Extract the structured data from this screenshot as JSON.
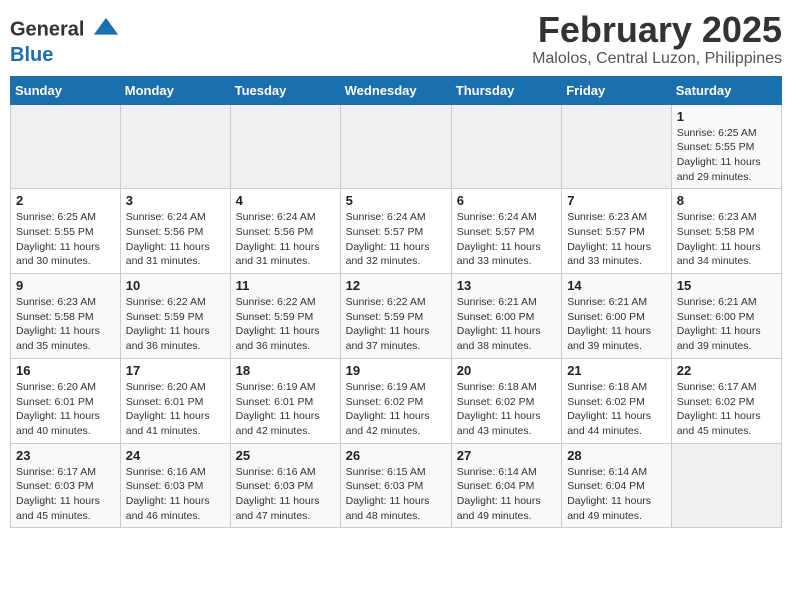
{
  "header": {
    "logo_general": "General",
    "logo_blue": "Blue",
    "month": "February 2025",
    "location": "Malolos, Central Luzon, Philippines"
  },
  "columns": [
    "Sunday",
    "Monday",
    "Tuesday",
    "Wednesday",
    "Thursday",
    "Friday",
    "Saturday"
  ],
  "weeks": [
    [
      {
        "day": "",
        "sunrise": "",
        "sunset": "",
        "daylight": ""
      },
      {
        "day": "",
        "sunrise": "",
        "sunset": "",
        "daylight": ""
      },
      {
        "day": "",
        "sunrise": "",
        "sunset": "",
        "daylight": ""
      },
      {
        "day": "",
        "sunrise": "",
        "sunset": "",
        "daylight": ""
      },
      {
        "day": "",
        "sunrise": "",
        "sunset": "",
        "daylight": ""
      },
      {
        "day": "",
        "sunrise": "",
        "sunset": "",
        "daylight": ""
      },
      {
        "day": "1",
        "sunrise": "Sunrise: 6:25 AM",
        "sunset": "Sunset: 5:55 PM",
        "daylight": "Daylight: 11 hours and 29 minutes."
      }
    ],
    [
      {
        "day": "2",
        "sunrise": "Sunrise: 6:25 AM",
        "sunset": "Sunset: 5:55 PM",
        "daylight": "Daylight: 11 hours and 30 minutes."
      },
      {
        "day": "3",
        "sunrise": "Sunrise: 6:24 AM",
        "sunset": "Sunset: 5:56 PM",
        "daylight": "Daylight: 11 hours and 31 minutes."
      },
      {
        "day": "4",
        "sunrise": "Sunrise: 6:24 AM",
        "sunset": "Sunset: 5:56 PM",
        "daylight": "Daylight: 11 hours and 31 minutes."
      },
      {
        "day": "5",
        "sunrise": "Sunrise: 6:24 AM",
        "sunset": "Sunset: 5:57 PM",
        "daylight": "Daylight: 11 hours and 32 minutes."
      },
      {
        "day": "6",
        "sunrise": "Sunrise: 6:24 AM",
        "sunset": "Sunset: 5:57 PM",
        "daylight": "Daylight: 11 hours and 33 minutes."
      },
      {
        "day": "7",
        "sunrise": "Sunrise: 6:23 AM",
        "sunset": "Sunset: 5:57 PM",
        "daylight": "Daylight: 11 hours and 33 minutes."
      },
      {
        "day": "8",
        "sunrise": "Sunrise: 6:23 AM",
        "sunset": "Sunset: 5:58 PM",
        "daylight": "Daylight: 11 hours and 34 minutes."
      }
    ],
    [
      {
        "day": "9",
        "sunrise": "Sunrise: 6:23 AM",
        "sunset": "Sunset: 5:58 PM",
        "daylight": "Daylight: 11 hours and 35 minutes."
      },
      {
        "day": "10",
        "sunrise": "Sunrise: 6:22 AM",
        "sunset": "Sunset: 5:59 PM",
        "daylight": "Daylight: 11 hours and 36 minutes."
      },
      {
        "day": "11",
        "sunrise": "Sunrise: 6:22 AM",
        "sunset": "Sunset: 5:59 PM",
        "daylight": "Daylight: 11 hours and 36 minutes."
      },
      {
        "day": "12",
        "sunrise": "Sunrise: 6:22 AM",
        "sunset": "Sunset: 5:59 PM",
        "daylight": "Daylight: 11 hours and 37 minutes."
      },
      {
        "day": "13",
        "sunrise": "Sunrise: 6:21 AM",
        "sunset": "Sunset: 6:00 PM",
        "daylight": "Daylight: 11 hours and 38 minutes."
      },
      {
        "day": "14",
        "sunrise": "Sunrise: 6:21 AM",
        "sunset": "Sunset: 6:00 PM",
        "daylight": "Daylight: 11 hours and 39 minutes."
      },
      {
        "day": "15",
        "sunrise": "Sunrise: 6:21 AM",
        "sunset": "Sunset: 6:00 PM",
        "daylight": "Daylight: 11 hours and 39 minutes."
      }
    ],
    [
      {
        "day": "16",
        "sunrise": "Sunrise: 6:20 AM",
        "sunset": "Sunset: 6:01 PM",
        "daylight": "Daylight: 11 hours and 40 minutes."
      },
      {
        "day": "17",
        "sunrise": "Sunrise: 6:20 AM",
        "sunset": "Sunset: 6:01 PM",
        "daylight": "Daylight: 11 hours and 41 minutes."
      },
      {
        "day": "18",
        "sunrise": "Sunrise: 6:19 AM",
        "sunset": "Sunset: 6:01 PM",
        "daylight": "Daylight: 11 hours and 42 minutes."
      },
      {
        "day": "19",
        "sunrise": "Sunrise: 6:19 AM",
        "sunset": "Sunset: 6:02 PM",
        "daylight": "Daylight: 11 hours and 42 minutes."
      },
      {
        "day": "20",
        "sunrise": "Sunrise: 6:18 AM",
        "sunset": "Sunset: 6:02 PM",
        "daylight": "Daylight: 11 hours and 43 minutes."
      },
      {
        "day": "21",
        "sunrise": "Sunrise: 6:18 AM",
        "sunset": "Sunset: 6:02 PM",
        "daylight": "Daylight: 11 hours and 44 minutes."
      },
      {
        "day": "22",
        "sunrise": "Sunrise: 6:17 AM",
        "sunset": "Sunset: 6:02 PM",
        "daylight": "Daylight: 11 hours and 45 minutes."
      }
    ],
    [
      {
        "day": "23",
        "sunrise": "Sunrise: 6:17 AM",
        "sunset": "Sunset: 6:03 PM",
        "daylight": "Daylight: 11 hours and 45 minutes."
      },
      {
        "day": "24",
        "sunrise": "Sunrise: 6:16 AM",
        "sunset": "Sunset: 6:03 PM",
        "daylight": "Daylight: 11 hours and 46 minutes."
      },
      {
        "day": "25",
        "sunrise": "Sunrise: 6:16 AM",
        "sunset": "Sunset: 6:03 PM",
        "daylight": "Daylight: 11 hours and 47 minutes."
      },
      {
        "day": "26",
        "sunrise": "Sunrise: 6:15 AM",
        "sunset": "Sunset: 6:03 PM",
        "daylight": "Daylight: 11 hours and 48 minutes."
      },
      {
        "day": "27",
        "sunrise": "Sunrise: 6:14 AM",
        "sunset": "Sunset: 6:04 PM",
        "daylight": "Daylight: 11 hours and 49 minutes."
      },
      {
        "day": "28",
        "sunrise": "Sunrise: 6:14 AM",
        "sunset": "Sunset: 6:04 PM",
        "daylight": "Daylight: 11 hours and 49 minutes."
      },
      {
        "day": "",
        "sunrise": "",
        "sunset": "",
        "daylight": ""
      }
    ]
  ]
}
